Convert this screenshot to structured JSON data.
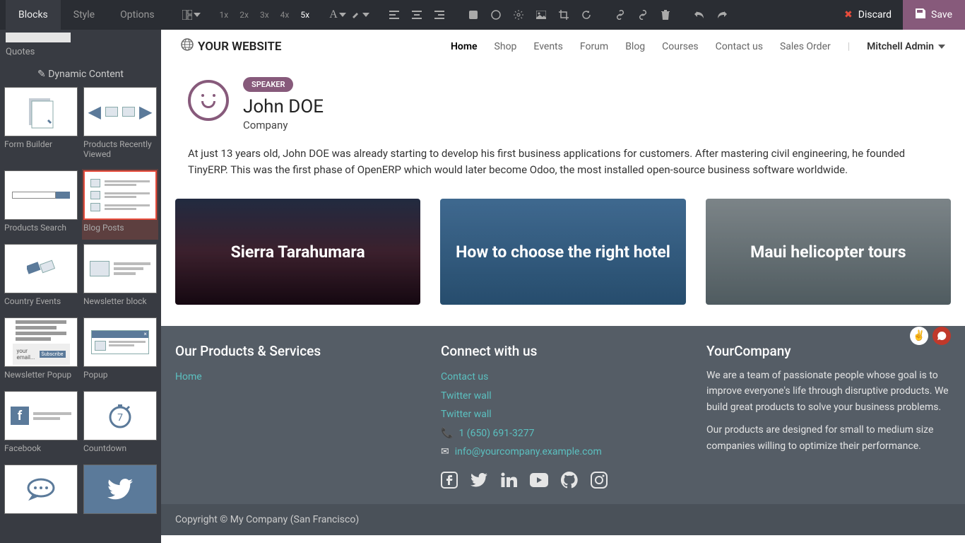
{
  "toolbar": {
    "tabs": [
      "Blocks",
      "Style",
      "Options"
    ],
    "active_tab": 0,
    "sizes": [
      "1x",
      "2x",
      "3x",
      "4x",
      "5x"
    ],
    "active_size": 4,
    "discard_label": "Discard",
    "save_label": "Save"
  },
  "sidebar": {
    "top_label": "Quotes",
    "section_title": "Dynamic Content",
    "blocks": [
      {
        "label": "Form Builder",
        "icon": "form"
      },
      {
        "label": "Products Recently Viewed",
        "icon": "recent"
      },
      {
        "label": "Products Search",
        "icon": "search"
      },
      {
        "label": "Blog Posts",
        "icon": "posts",
        "selected": true
      },
      {
        "label": "Country Events",
        "icon": "ticket"
      },
      {
        "label": "Newsletter block",
        "icon": "imgtext"
      },
      {
        "label": "Newsletter Popup",
        "icon": "popup"
      },
      {
        "label": "Popup",
        "icon": "popup2"
      },
      {
        "label": "Facebook",
        "icon": "fb"
      },
      {
        "label": "Countdown",
        "icon": "clock"
      },
      {
        "label": "",
        "icon": "chat"
      },
      {
        "label": "",
        "icon": "tw"
      }
    ],
    "newsletter_placeholder": "your email...",
    "newsletter_button": "Subscribe"
  },
  "site": {
    "logo_text": "YOUR WEBSITE",
    "nav": [
      "Home",
      "Shop",
      "Events",
      "Forum",
      "Blog",
      "Courses",
      "Contact us",
      "Sales Order"
    ],
    "active_nav": 0,
    "user": "Mitchell Admin"
  },
  "speaker": {
    "badge": "SPEAKER",
    "name": "John DOE",
    "company": "Company",
    "bio": "At just 13 years old, John DOE was already starting to develop his first business applications for customers. After mastering civil engineering, he founded TinyERP. This was the first phase of OpenERP which would later become Odoo, the most installed open-source business software worldwide."
  },
  "cards": [
    {
      "title": "Sierra Tarahumara"
    },
    {
      "title": "How to choose the right hotel"
    },
    {
      "title": "Maui helicopter tours"
    }
  ],
  "footer": {
    "col1_title": "Our Products & Services",
    "col1_links": [
      "Home"
    ],
    "col2_title": "Connect with us",
    "col2_links": [
      "Contact us",
      "Twitter wall",
      "Twitter wall"
    ],
    "phone": "1 (650) 691-3277",
    "email": "info@yourcompany.example.com",
    "col3_title": "YourCompany",
    "col3_p1": "We are a team of passionate people whose goal is to improve everyone's life through disruptive products. We build great products to solve your business problems.",
    "col3_p2": "Our products are designed for small to medium size companies willing to optimize their performance."
  },
  "copyright": "Copyright © My Company (San Francisco)",
  "colors": {
    "primary": "#875a7b",
    "link": "#5bc0c0"
  }
}
